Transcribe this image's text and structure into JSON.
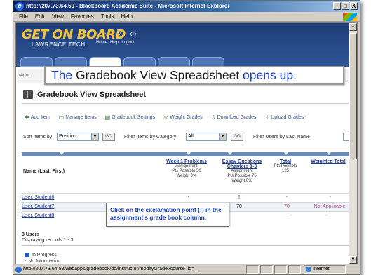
{
  "window": {
    "title": "http://207.73.64.59 - Blackboard Academic Suite - Microsoft Internet Explorer",
    "controls": [
      "_",
      "□",
      "X"
    ]
  },
  "menubar": {
    "items": [
      "File",
      "Edit",
      "View",
      "Favorites",
      "Tools",
      "Help"
    ]
  },
  "bb_header": {
    "logo_main": "GET ON BOARD",
    "logo_sub": "LAWRENCE TECH",
    "nav": [
      {
        "icon": "home-icon",
        "label": "Home"
      },
      {
        "icon": "help-icon",
        "label": "Help"
      },
      {
        "icon": "logout-icon",
        "label": "Logout"
      }
    ]
  },
  "breadcrumb": {
    "text": "FACUL"
  },
  "callout_top": {
    "part1": "The",
    "part2": " Gradebook View Spreadsheet ",
    "part3": "opens up."
  },
  "page": {
    "title": "Gradebook View Spreadsheet"
  },
  "actions": [
    {
      "name": "add-item",
      "label": "Add Item",
      "icon": "add-icon"
    },
    {
      "name": "manage-items",
      "label": "Manage Items",
      "icon": "list-icon"
    },
    {
      "name": "gradebook-settings",
      "label": "Gradebook Settings",
      "icon": "settings-icon"
    },
    {
      "name": "weight-grades",
      "label": "Weight Grades",
      "icon": "weight-icon"
    },
    {
      "name": "download-grades",
      "label": "Download Grades",
      "icon": "download-icon"
    },
    {
      "name": "upload-grades",
      "label": "Upload Grades",
      "icon": "upload-icon"
    }
  ],
  "filters": {
    "sort_label": "Sort Items by",
    "sort_value": "Position",
    "go1": "GO",
    "filter_label": "Filter Items by Category",
    "filter_value": "All",
    "go2": "GO",
    "user_filter_label": "Filter Users by Last Name"
  },
  "grid": {
    "name_header": "Name (Last, First)",
    "columns": [
      {
        "name": "Week 1 Problems",
        "type": "Assignment",
        "possible": "Pts Possible 50",
        "weight": "Weight 0%"
      },
      {
        "name": "Essay Questions Chapters 1-3",
        "type": "Assignment",
        "possible": "Pts Possible 75",
        "weight": "Weight 0%"
      },
      {
        "name": "Total",
        "type": "",
        "possible": "Pts Possible 125",
        "weight": ""
      },
      {
        "name": "Weighted Total",
        "type": "",
        "possible": "",
        "weight": ""
      }
    ],
    "rows": [
      {
        "name": "User, Student6",
        "c1": "-",
        "c2": "!",
        "total": "-",
        "weighted": "-"
      },
      {
        "name": "User, Student7",
        "c1": "",
        "c2": "70",
        "total": "70",
        "weighted": "Not Applicable"
      },
      {
        "name": "User, Student8",
        "c1": "",
        "c2": "",
        "total": "-",
        "weighted": "-"
      }
    ],
    "users_count": "3 Users",
    "displaying": "Displaying records 1 - 3"
  },
  "legend": [
    {
      "icon": "in-progress-icon",
      "label": "In Progress"
    },
    {
      "icon": "dash-icon",
      "label": "No Information"
    }
  ],
  "callout_bottom": {
    "text": "Click on the exclamation point (!) in the assignment's grade book column."
  },
  "statusbar": {
    "url": "http://207.73.64.59/webapps/gradebook/do/instructor/modifyGrade?course_id=_",
    "zone": "Internet"
  }
}
